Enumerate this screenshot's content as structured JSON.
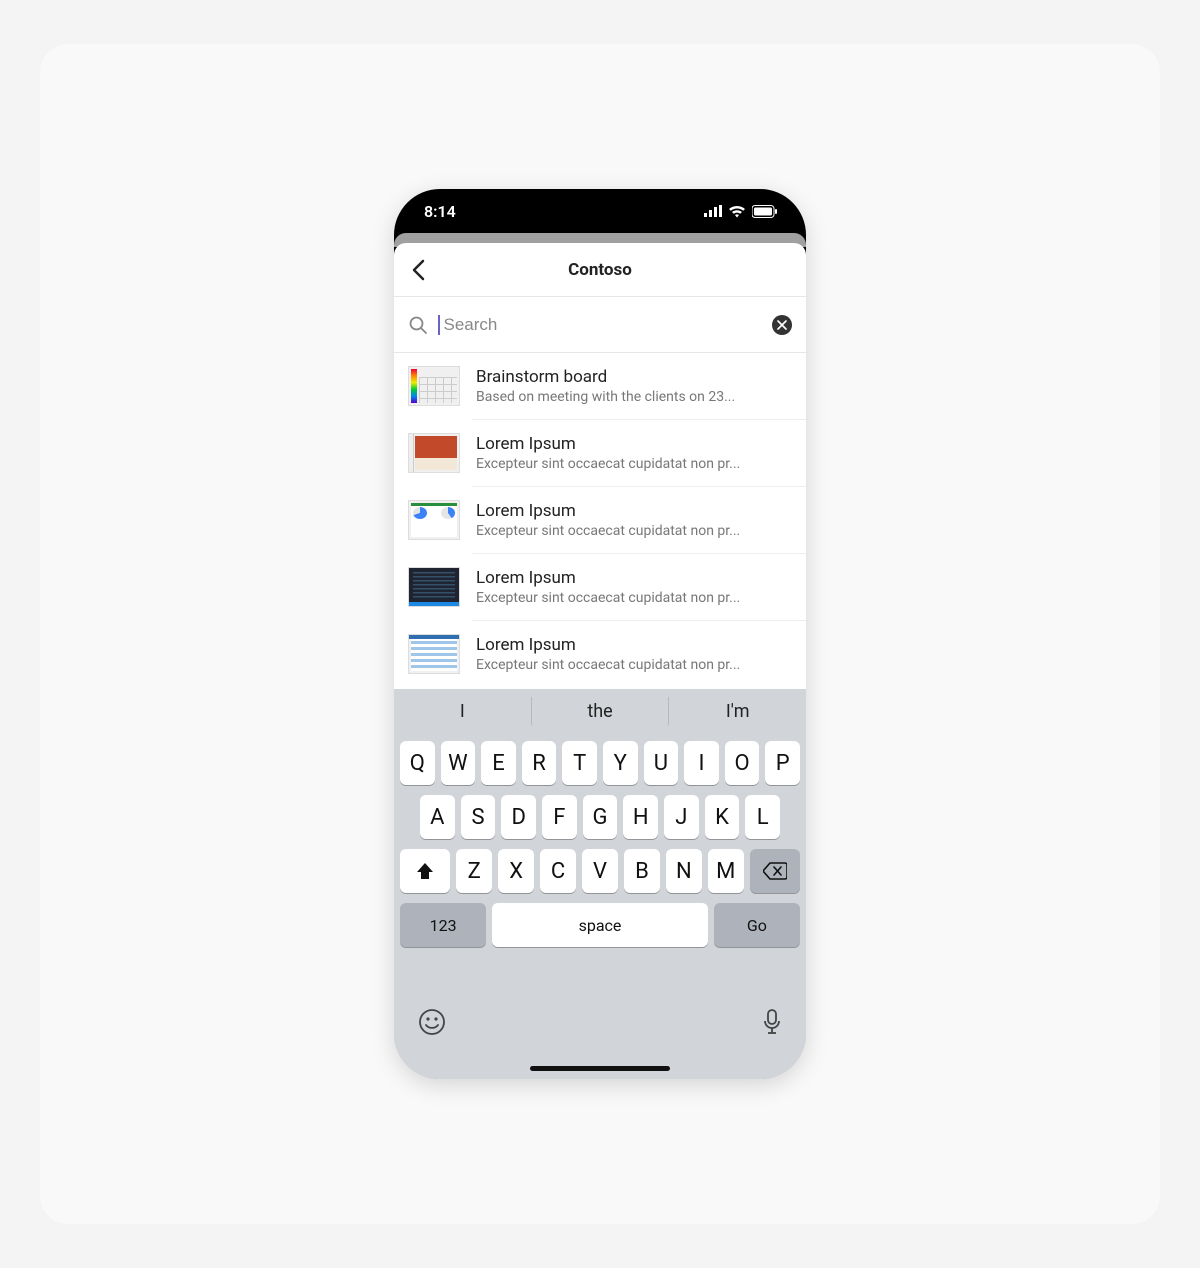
{
  "statusbar": {
    "time": "8:14"
  },
  "header": {
    "title": "Contoso"
  },
  "search": {
    "placeholder": "Search",
    "value": ""
  },
  "list": {
    "items": [
      {
        "title": "Brainstorm board",
        "subtitle": "Based on meeting with the clients on 23..."
      },
      {
        "title": "Lorem Ipsum",
        "subtitle": "Excepteur sint occaecat cupidatat non pr..."
      },
      {
        "title": "Lorem Ipsum",
        "subtitle": "Excepteur sint occaecat cupidatat non pr..."
      },
      {
        "title": "Lorem Ipsum",
        "subtitle": "Excepteur sint occaecat cupidatat non pr..."
      },
      {
        "title": "Lorem Ipsum",
        "subtitle": "Excepteur sint occaecat cupidatat non pr..."
      }
    ]
  },
  "keyboard": {
    "suggestions": [
      "I",
      "the",
      "I'm"
    ],
    "row1": [
      "Q",
      "W",
      "E",
      "R",
      "T",
      "Y",
      "U",
      "I",
      "O",
      "P"
    ],
    "row2": [
      "A",
      "S",
      "D",
      "F",
      "G",
      "H",
      "J",
      "K",
      "L"
    ],
    "row3": [
      "Z",
      "X",
      "C",
      "V",
      "B",
      "N",
      "M"
    ],
    "numKey": "123",
    "spaceKey": "space",
    "goKey": "Go"
  }
}
